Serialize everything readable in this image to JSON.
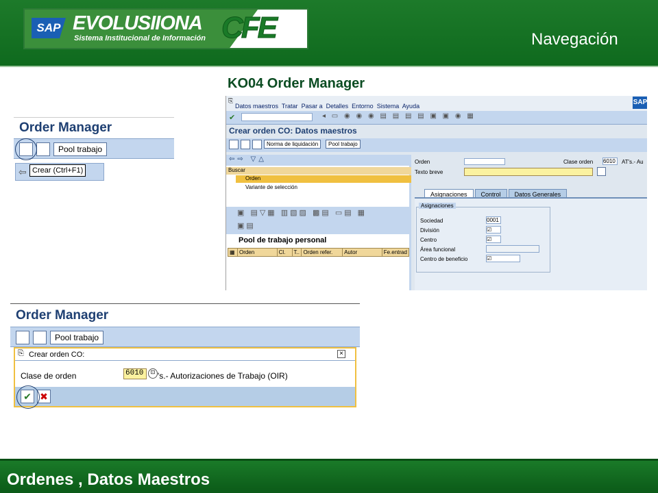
{
  "header": {
    "logo_sap": "SAP",
    "logo_title": "EVOLUSIIONA",
    "logo_subtitle": "Sistema Institucional de Información",
    "logo_cfe": "CFE",
    "section": "Navegación"
  },
  "slide_title": "KO04 Order Manager",
  "footer": {
    "title": "Ordenes , Datos Maestros"
  },
  "panel1": {
    "title": "Order Manager",
    "pool_button": "Pool trabajo",
    "tooltip": "Crear  (Ctrl+F1)"
  },
  "panel2": {
    "title": "Order Manager",
    "pool_button": "Pool trabajo",
    "dialog_title": "Crear orden CO:",
    "class_label": "Clase de orden",
    "class_value": "6010",
    "class_desc": "'s.- Autorizaciones de Trabajo  (OIR)"
  },
  "sap": {
    "menu": [
      "Datos maestros",
      "Tratar",
      "Pasar a",
      "Detalles",
      "Entorno",
      "Sistema",
      "Ayuda"
    ],
    "screen_title": "Crear orden CO: Datos maestros",
    "toolbar": [
      "Norma de liquidación",
      "Pool trabajo"
    ],
    "search_label": "Buscar",
    "tree": [
      "Orden",
      "Variante de selección"
    ],
    "pool_title": "Pool de trabajo personal",
    "grid_cols": [
      "Orden",
      "Cl.",
      "T..",
      "Orden refer.",
      "Autor",
      "Fe.entrad"
    ],
    "order_label": "Orden",
    "class_label": "Clase orden",
    "class_value": "6010",
    "class_desc": "AT's.- Au",
    "short_text_label": "Texto breve",
    "tabs": [
      "Asignaciones",
      "Control",
      "Datos Generales"
    ],
    "group_label": "Asignaciones",
    "fields": [
      {
        "label": "Sociedad",
        "value": "0001"
      },
      {
        "label": "División",
        "value": "☑"
      },
      {
        "label": "Centro",
        "value": "☑"
      },
      {
        "label": "Área funcional",
        "value": ""
      },
      {
        "label": "Centro de beneficio",
        "value": "☑"
      }
    ]
  }
}
